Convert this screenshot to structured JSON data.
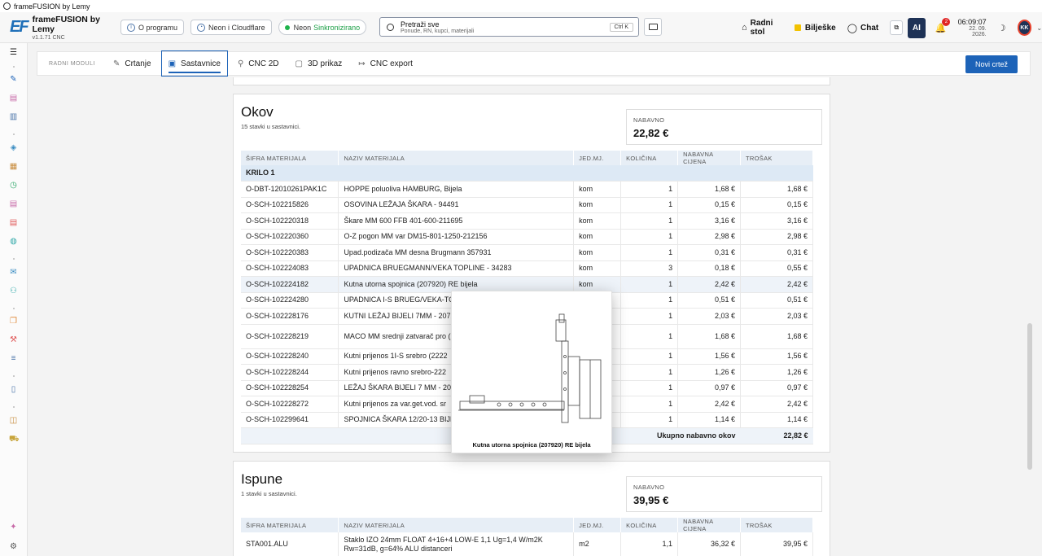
{
  "window": {
    "title": "frameFUSION by Lemy"
  },
  "brand": {
    "mark": "EF",
    "name": "frameFUSION by Lemy",
    "version": "v1.1.71 CNC"
  },
  "header": {
    "about": "O programu",
    "neon_cloudflare": "Neon i Cloudflare",
    "neon": "Neon",
    "neon_status": "Sinkronizirano",
    "search_title": "Pretraži sve",
    "search_sub": "Ponude, RN, kupci, materijali",
    "search_kbd": "Ctrl K",
    "desktop": "Radni stol",
    "notes": "Bilješke",
    "chat": "Chat",
    "ai": "AI",
    "bell_count": "2",
    "time": "06:09:07",
    "date": "22. 09. 2026.",
    "avatar": "KK"
  },
  "toolbar": {
    "label": "RADNI MODULI",
    "tabs": [
      "Crtanje",
      "Sastavnice",
      "CNC 2D",
      "3D prikaz",
      "CNC export"
    ],
    "new_button": "Novi crtež"
  },
  "columns": [
    "ŠIFRA MATERIJALA",
    "NAZIV MATERIJALA",
    "JED.MJ.",
    "KOLIČINA",
    "NABAVNA CIJENA",
    "TROŠAK"
  ],
  "okov": {
    "title": "Okov",
    "subtitle": "15 stavki u sastavnici.",
    "nab_label": "NABAVNO",
    "nab_value": "22,82 €",
    "group": "KRILO 1",
    "total_label": "Ukupno nabavno okov",
    "total_value": "22,82 €",
    "rows": [
      [
        "O-DBT-12010261PAK1C",
        "HOPPE poluoliva HAMBURG, Bijela",
        "kom",
        "1",
        "1,68 €",
        "1,68 €"
      ],
      [
        "O-SCH-102215826",
        "OSOVINA LEŽAJA ŠKARA - 94491",
        "kom",
        "1",
        "0,15 €",
        "0,15 €"
      ],
      [
        "O-SCH-102220318",
        "Škare MM 600 FFB 401-600-211695",
        "kom",
        "1",
        "3,16 €",
        "3,16 €"
      ],
      [
        "O-SCH-102220360",
        "O-Z pogon MM var DM15-801-1250-212156",
        "kom",
        "1",
        "2,98 €",
        "2,98 €"
      ],
      [
        "O-SCH-102220383",
        "Upad.podizača MM desna Brugmann 357931",
        "kom",
        "1",
        "0,31 €",
        "0,31 €"
      ],
      [
        "O-SCH-102224083",
        "UPADNICA BRUEGMANN/VEKA TOPLINE - 34283",
        "kom",
        "3",
        "0,18 €",
        "0,55 €"
      ],
      [
        "O-SCH-102224182",
        "Kutna utorna spojnica (207920) RE bijela",
        "kom",
        "1",
        "2,42 €",
        "2,42 €"
      ],
      [
        "O-SCH-102224280",
        "UPADNICA I-S BRUEG/VEKA-TO",
        "",
        "1",
        "0,51 €",
        "0,51 €"
      ],
      [
        "O-SCH-102228176",
        "KUTNI LEŽAJ BIJELI 7MM - 2072",
        "",
        "1",
        "2,03 €",
        "2,03 €"
      ],
      [
        "O-SCH-102228219",
        "MACO MM srednji zatvarač pro (201840)",
        "",
        "1",
        "1,68 €",
        "1,68 €"
      ],
      [
        "O-SCH-102228240",
        "Kutni prijenos 1I-S srebro (2222",
        "",
        "1",
        "1,56 €",
        "1,56 €"
      ],
      [
        "O-SCH-102228244",
        "Kutni prijenos ravno srebro-222",
        "",
        "1",
        "1,26 €",
        "1,26 €"
      ],
      [
        "O-SCH-102228254",
        "LEŽAJ ŠKARA BIJELI 7 MM - 204",
        "",
        "1",
        "0,97 €",
        "0,97 €"
      ],
      [
        "O-SCH-102228272",
        "Kutni prijenos za var.get.vod. sr",
        "",
        "1",
        "2,42 €",
        "2,42 €"
      ],
      [
        "O-SCH-102299641",
        "SPOJNICA ŠKARA 12/20-13 BIJE",
        "",
        "1",
        "1,14 €",
        "1,14 €"
      ]
    ]
  },
  "ispune": {
    "title": "Ispune",
    "subtitle": "1 stavki u sastavnici.",
    "nab_label": "NABAVNO",
    "nab_value": "39,95 €",
    "rows": [
      [
        "STA001.ALU",
        "Staklo IZO 24mm FLOAT 4+16+4 LOW-E 1,1 Ug=1,4 W/m2K Rw=31dB, g=64% ALU distanceri",
        "m2",
        "1,1",
        "36,32 €",
        "39,95 €"
      ]
    ]
  },
  "popup": {
    "caption": "Kutna utorna spojnica (207920) RE bijela"
  }
}
